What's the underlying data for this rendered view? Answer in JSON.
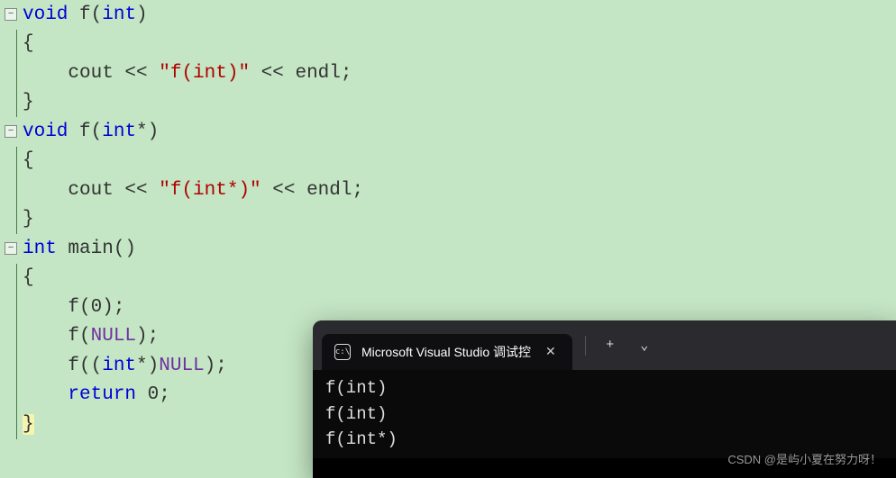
{
  "code": {
    "lines": [
      {
        "indent": 0,
        "segments": [
          {
            "t": "void",
            "c": "keyword"
          },
          {
            "t": " f("
          },
          {
            "t": "int",
            "c": "keyword"
          },
          {
            "t": ")"
          }
        ],
        "fold": true
      },
      {
        "indent": 0,
        "segments": [
          {
            "t": "{"
          }
        ]
      },
      {
        "indent": 1,
        "segments": [
          {
            "t": "    cout << "
          },
          {
            "t": "\"f(int)\"",
            "c": "string"
          },
          {
            "t": " << endl;"
          }
        ]
      },
      {
        "indent": 0,
        "segments": [
          {
            "t": "}"
          }
        ]
      },
      {
        "indent": 0,
        "segments": [
          {
            "t": "void",
            "c": "keyword"
          },
          {
            "t": " f("
          },
          {
            "t": "int",
            "c": "keyword"
          },
          {
            "t": "*)"
          }
        ],
        "fold": true
      },
      {
        "indent": 0,
        "segments": [
          {
            "t": "{"
          }
        ]
      },
      {
        "indent": 1,
        "segments": [
          {
            "t": "    cout << "
          },
          {
            "t": "\"f(int*)\"",
            "c": "string"
          },
          {
            "t": " << endl;"
          }
        ]
      },
      {
        "indent": 0,
        "segments": [
          {
            "t": "}"
          }
        ]
      },
      {
        "indent": 0,
        "segments": [
          {
            "t": "int",
            "c": "keyword"
          },
          {
            "t": " main()"
          }
        ],
        "fold": true
      },
      {
        "indent": 0,
        "segments": [
          {
            "t": "{"
          }
        ]
      },
      {
        "indent": 1,
        "segments": [
          {
            "t": "    f("
          },
          {
            "t": "0"
          },
          {
            "t": ");"
          }
        ]
      },
      {
        "indent": 1,
        "segments": [
          {
            "t": "    f("
          },
          {
            "t": "NULL",
            "c": "macro"
          },
          {
            "t": ");"
          }
        ]
      },
      {
        "indent": 1,
        "segments": [
          {
            "t": "    f(("
          },
          {
            "t": "int",
            "c": "keyword"
          },
          {
            "t": "*)"
          },
          {
            "t": "NULL",
            "c": "macro"
          },
          {
            "t": ");"
          }
        ]
      },
      {
        "indent": 1,
        "segments": [
          {
            "t": "    "
          },
          {
            "t": "return",
            "c": "keyword"
          },
          {
            "t": " "
          },
          {
            "t": "0"
          },
          {
            "t": ";"
          }
        ]
      },
      {
        "indent": 0,
        "segments": [
          {
            "t": "}",
            "c": "highlight-brace"
          }
        ]
      }
    ]
  },
  "terminal": {
    "tab": {
      "icon_text": "c:\\",
      "title": "Microsoft Visual Studio 调试控",
      "new_tab_label": "+",
      "dropdown_label": "⌄"
    },
    "output": [
      "f(int)",
      "f(int)",
      "f(int*)"
    ]
  },
  "watermark": "CSDN @是屿小夏在努力呀！"
}
